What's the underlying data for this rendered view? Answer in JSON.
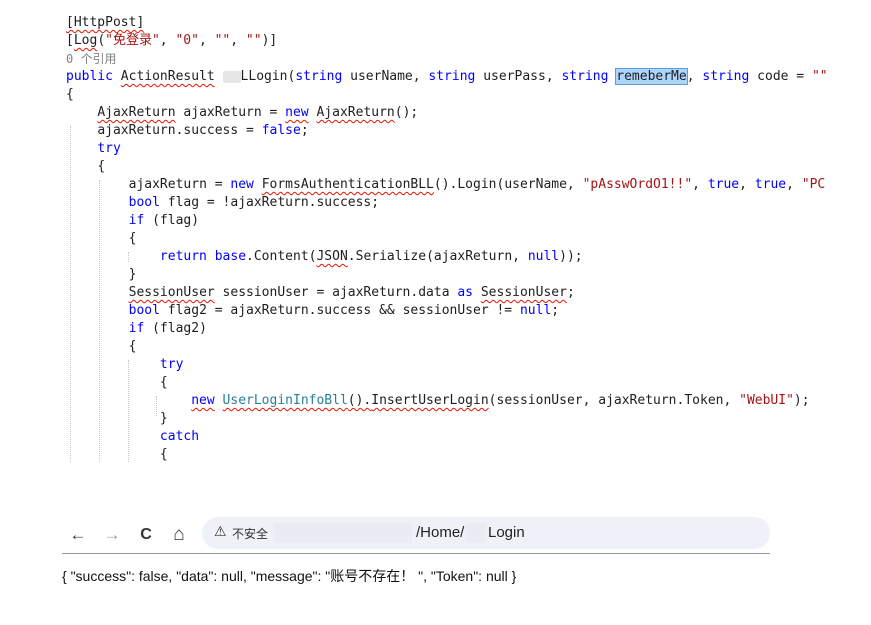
{
  "code": {
    "attr_httppost": "[HttpPost]",
    "attr_log_open": "[",
    "attr_log_name": "Log",
    "attr_log_paren": "(",
    "attr_log_s1": "\"免登录\"",
    "attr_log_comma1": ", ",
    "attr_log_s2": "\"0\"",
    "attr_log_comma2": ", ",
    "attr_log_s3": "\"\"",
    "attr_log_comma3": ", ",
    "attr_log_s4": "\"\"",
    "attr_log_close": ")]",
    "ref_count": "0 个引用",
    "l4_public": "public",
    "l4_type": "ActionResult",
    "l4_method": "LLogin(",
    "l4_string1": "string",
    "l4_p1": " userName, ",
    "l4_string2": "string",
    "l4_p2": " userPass, ",
    "l4_string3": "string",
    "l4_remember": "remeberMe",
    "l4_comma": ", ",
    "l4_string4": "string",
    "l4_p4": " code = ",
    "l4_empty": "\"\"",
    "l4_close": ")",
    "brace_open": "{",
    "brace_close": "}",
    "l6_type": "AjaxReturn",
    "l6_var": " ajaxReturn = ",
    "l6_new": "new",
    "l6_ctor": "AjaxReturn",
    "l6_end": "();",
    "l7_text": "ajaxReturn.success = ",
    "l7_false": "false",
    "l7_semi": ";",
    "l8_try": "try",
    "l10_a": "ajaxReturn = ",
    "l10_new": "new",
    "l10_cls": "FormsAuthenticationBLL",
    "l10_b": "().Login(userName, ",
    "l10_pw": "\"pAsswOrdO1!!\"",
    "l10_c": ", ",
    "l10_true1": "true",
    "l10_d": ", ",
    "l10_true2": "true",
    "l10_e": ", ",
    "l10_pc": "\"PC\"",
    "l10_f": ");",
    "l11_bool": "bool",
    "l11_rest": " flag = !ajaxReturn.success;",
    "l12_if": "if",
    "l12_rest": " (flag)",
    "l14_return": "return",
    "l14_base": "base",
    "l14_a": ".Content(",
    "l14_json": "JSON",
    "l14_b": ".Serialize(ajaxReturn, ",
    "l14_null": "null",
    "l14_c": "));",
    "l16_type": "SessionUser",
    "l16_a": " sessionUser = ajaxReturn.data ",
    "l16_as": "as",
    "l16_cast": "SessionUser",
    "l16_semi": ";",
    "l17_bool": "bool",
    "l17_a": " flag2 = ajaxReturn.success && sessionUser != ",
    "l17_null": "null",
    "l17_semi": ";",
    "l18_if": "if",
    "l18_rest": " (flag2)",
    "l20_try": "try",
    "l22_new": "new",
    "l22_cls": "UserLoginInfoBll",
    "l22_a": "().",
    "l22_m": "InsertUserLogin",
    "l22_b": "(sessionUser, ajaxReturn.Token, ",
    "l22_s": "\"WebUI\"",
    "l22_c": ");",
    "l24_catch": "catch"
  },
  "browser": {
    "back_icon": "←",
    "forward_icon": "→",
    "reload_icon": "C",
    "home_icon": "⌂",
    "warning_icon": "⚠",
    "security_label": "不安全",
    "url_path_a": "/Home/",
    "url_path_b": "Login"
  },
  "response": {
    "json_text": "{ \"success\": false, \"data\": null, \"message\": \"账号不存在！ \", \"Token\": null }"
  }
}
